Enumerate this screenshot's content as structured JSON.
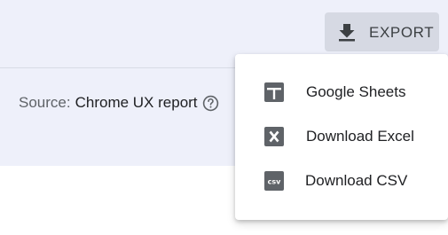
{
  "toolbar": {
    "export_label": "EXPORT",
    "export_icon": "download-icon"
  },
  "source": {
    "prefix": "Source:",
    "value": "Chrome UX report",
    "help_icon": "help-circle-icon"
  },
  "export_menu": {
    "items": [
      {
        "label": "Google Sheets",
        "icon": "google-sheets-icon"
      },
      {
        "label": "Download Excel",
        "icon": "excel-icon"
      },
      {
        "label": "Download CSV",
        "icon": "csv-icon",
        "icon_text": "csv"
      }
    ]
  },
  "colors": {
    "band_background": "#eef0fa",
    "export_button_background": "#d6d9e3",
    "icon_gray": "#5f6368",
    "text_primary": "#202124"
  }
}
